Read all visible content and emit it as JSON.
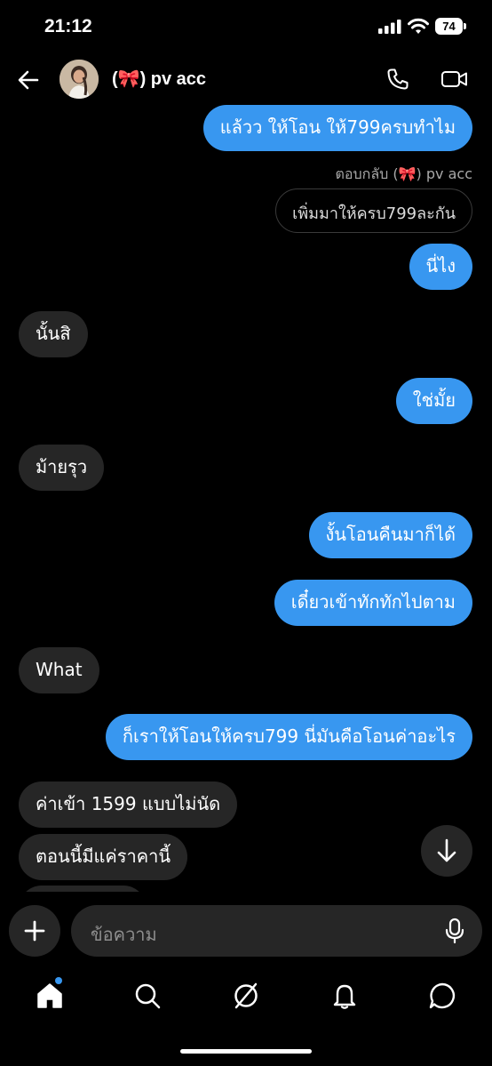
{
  "status": {
    "time": "21:12",
    "battery": "74"
  },
  "header": {
    "title": "(🎀) pv acc"
  },
  "messages": [
    {
      "dir": "out",
      "text": "แล้วว ให้โอน ให้799ครบทำไม"
    },
    {
      "dir": "in",
      "text": "นั้นสิ"
    },
    {
      "dir": "out",
      "text": "นี่ไง"
    },
    {
      "dir": "out",
      "text": "ใช่มั้ย"
    },
    {
      "dir": "in",
      "text": "ม้ายรุว"
    },
    {
      "dir": "out",
      "text": "งั้นโอนคืนมาก็ได้"
    },
    {
      "dir": "out",
      "text": "เดี๋ยวเข้าทักทักไปตาม"
    },
    {
      "dir": "in",
      "text": "What"
    },
    {
      "dir": "out",
      "text": "ก็เราให้โอนให้ครบ799 นี่มันคือโอนค่าอะไร"
    },
    {
      "dir": "in",
      "text": "ค่าเข้า 1599 แบบไม่นัด"
    },
    {
      "dir": "in",
      "text": "ตอนนี้มีแค่ราคานี้"
    }
  ],
  "reply": {
    "caption": "ตอบกลับ (🎀) pv acc",
    "quote": "เพิ่มมาให้ครบ799ละกัน"
  },
  "composer": {
    "placeholder": "ข้อความ"
  },
  "colors": {
    "accent": "#3897f0",
    "incoming": "#262626",
    "background": "#000000"
  },
  "icons": [
    "back-arrow-icon",
    "phone-icon",
    "video-icon",
    "plus-icon",
    "mic-icon",
    "arrow-down-icon",
    "home-icon",
    "search-icon",
    "explore-icon",
    "bell-icon",
    "chat-icon"
  ]
}
